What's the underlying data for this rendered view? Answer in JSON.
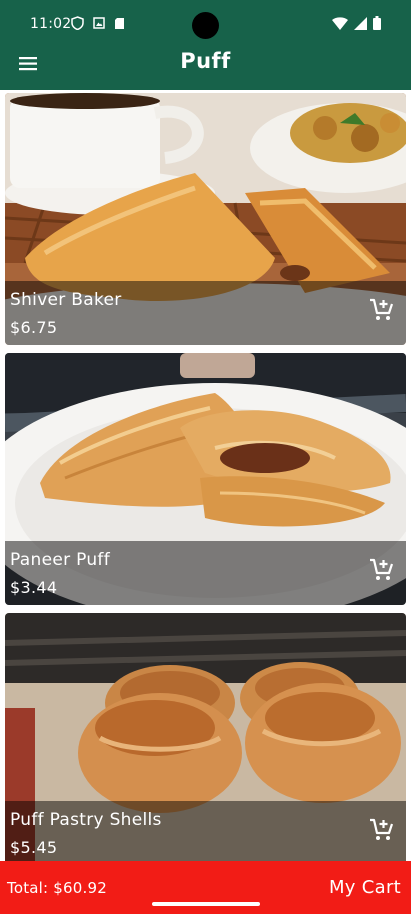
{
  "status_bar": {
    "time": "11:02"
  },
  "app_bar": {
    "title": "Puff",
    "menu_icon": "hamburger-menu-icon"
  },
  "products": [
    {
      "name": "Shiver Baker",
      "price": "$6.75",
      "image": "puff-with-coffee-and-bread",
      "cart_icon": "add-to-cart-icon"
    },
    {
      "name": "Paneer Puff",
      "price": "$3.44",
      "image": "flaky-puff-on-plate",
      "cart_icon": "add-to-cart-icon"
    },
    {
      "name": "Puff Pastry Shells",
      "price": "$5.45",
      "image": "pastry-shells-on-tray",
      "cart_icon": "add-to-cart-icon"
    }
  ],
  "footer": {
    "total": "Total: $60.92",
    "cart_label": "My Cart"
  },
  "colors": {
    "primary": "#17624a",
    "footer": "#f21c16",
    "text_on_color": "#ffffff"
  }
}
